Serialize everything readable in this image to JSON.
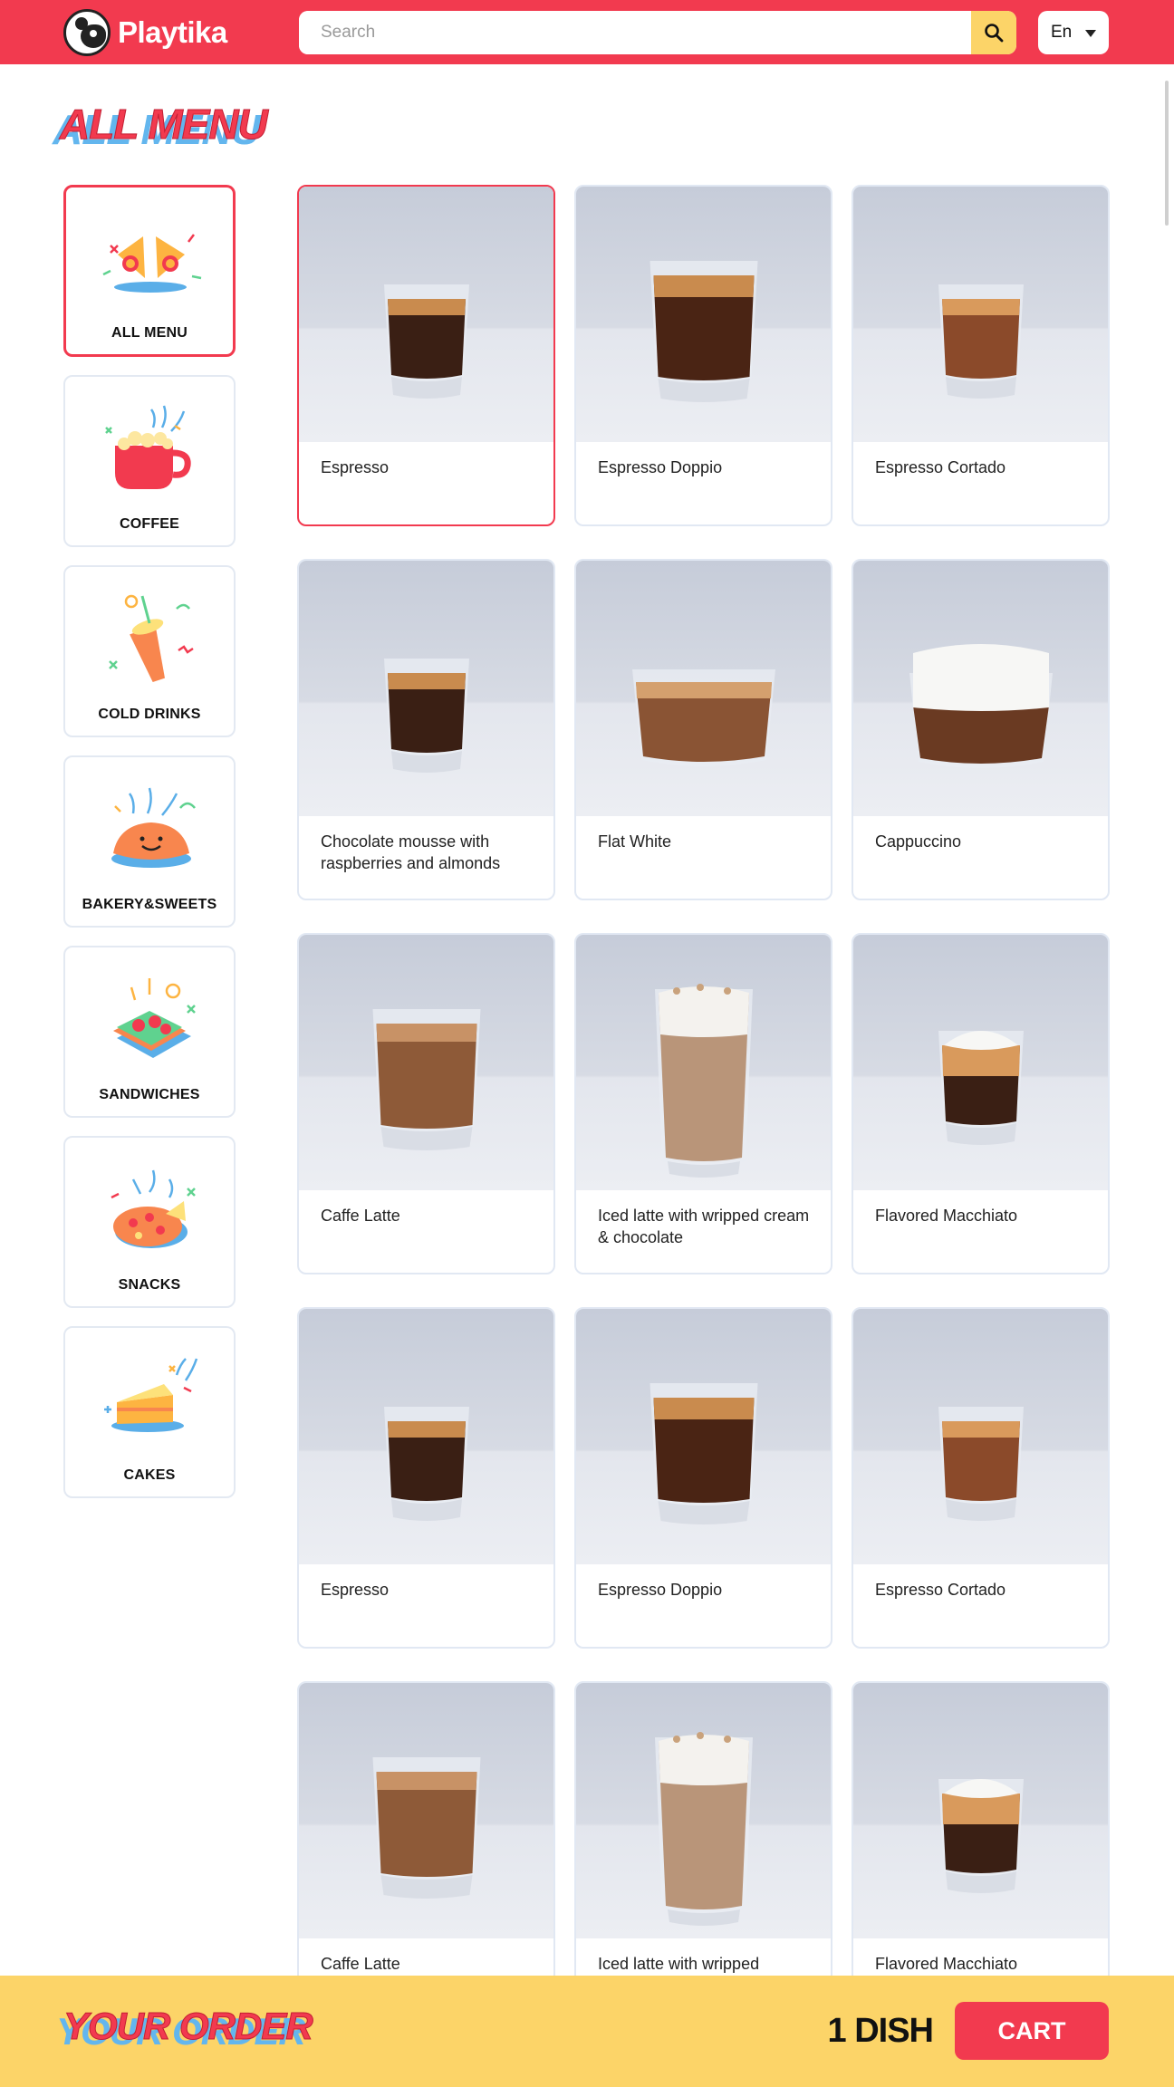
{
  "header": {
    "brand": "Playtika",
    "search_placeholder": "Search",
    "language": "En",
    "brand_color": "#f23a4f",
    "search_button_color": "#fcd468"
  },
  "page": {
    "title": "ALL MENU"
  },
  "sidebar": {
    "items": [
      {
        "label": "ALL MENU",
        "icon": "party-popper-icon",
        "active": true
      },
      {
        "label": "COFFEE",
        "icon": "coffee-cup-icon"
      },
      {
        "label": "COLD  DRINKS",
        "icon": "cold-drink-icon"
      },
      {
        "label": "BAKERY&SWEETS",
        "icon": "croissant-icon"
      },
      {
        "label": "SANDWICHES",
        "icon": "sandwich-icon"
      },
      {
        "label": "SNACKS",
        "icon": "pizza-icon"
      },
      {
        "label": "CAKES",
        "icon": "cake-icon"
      }
    ]
  },
  "products": [
    {
      "name": "Espresso",
      "selected": true
    },
    {
      "name": "Espresso Doppio"
    },
    {
      "name": "Espresso Cortado"
    },
    {
      "name": "Chocolate mousse with raspberries and almonds"
    },
    {
      "name": "Flat White"
    },
    {
      "name": "Cappuccino"
    },
    {
      "name": "Caffe Latte"
    },
    {
      "name": "Iced latte with wripped cream & chocolate"
    },
    {
      "name": "Flavored Macchiato"
    },
    {
      "name": "Espresso"
    },
    {
      "name": "Espresso Doppio"
    },
    {
      "name": "Espresso Cortado"
    },
    {
      "name": "Caffe Latte"
    },
    {
      "name": "Iced latte with wripped"
    },
    {
      "name": "Flavored Macchiato"
    }
  ],
  "order_bar": {
    "title": "YOUR ORDER",
    "count": "1 DISH",
    "cart_label": "CART",
    "background": "#fcd468"
  }
}
